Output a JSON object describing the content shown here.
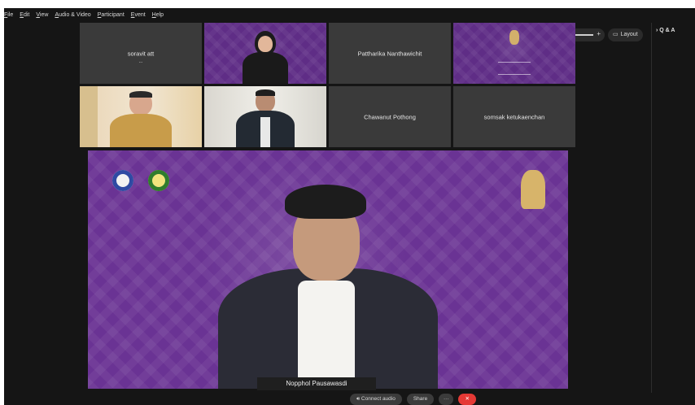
{
  "menu": [
    "File",
    "Edit",
    "View",
    "Audio & Video",
    "Participant",
    "Event",
    "Help"
  ],
  "controls": {
    "zoom_out_icon": "−",
    "zoom_in_icon": "+",
    "layout_label": "Layout",
    "qa_label": "Q & A"
  },
  "participants": {
    "soravit": {
      "name": "soravit att",
      "status": "..."
    },
    "pattharika": {
      "name": "Pattharika Nanthawichit"
    },
    "chawanut": {
      "name": "Chawanut Pothong"
    },
    "somsak": {
      "name": "somsak ketukaenchan"
    }
  },
  "main_speaker": {
    "name": "Nopphol Pausawasdi"
  },
  "bottom": {
    "connect_audio": "Connect audio",
    "share": "Share",
    "more": "···",
    "leave_icon": "✕"
  },
  "colors": {
    "accent": "#6a3394",
    "leave": "#e53935",
    "tile_bg": "#3a3a3a"
  }
}
